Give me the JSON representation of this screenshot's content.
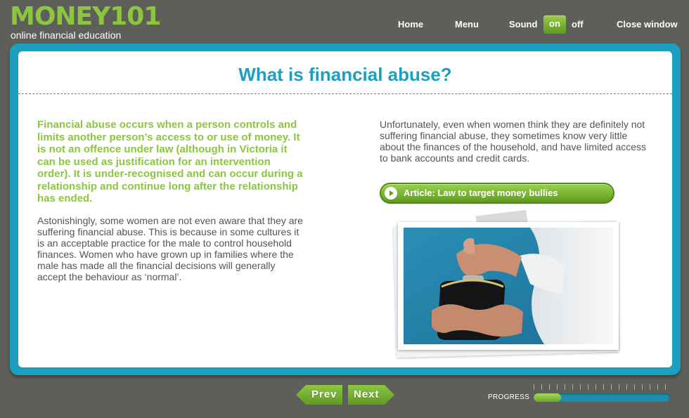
{
  "brand": {
    "logo_text": "MONEY101",
    "tagline": "online financial education"
  },
  "topnav": {
    "home": "Home",
    "menu": "Menu",
    "sound": "Sound",
    "sound_on": "on",
    "sound_off": "off",
    "close": "Close window"
  },
  "page": {
    "title": "What is financial abuse?",
    "intro": "Financial abuse occurs when a person controls and limits another person’s access to or use of money. It is not an offence under law (although in Victoria it can be used as justification for an intervention order). It is under-recognised and can occur during a relationship and continue long after the relationship has ended.",
    "body_left": "Astonishingly, some women are not even aware that they are suffering financial abuse. This is because in some cultures it is an acceptable practice for the male to control household finances. Women who have grown up in families where the male has made all the financial decisions will generally accept the behaviour as ‘normal’.",
    "body_right": "Unfortunately, even when women think they are definitely not suffering financial abuse, they sometimes know very little about the finances of the household, and have limited access to bank accounts and credit cards.",
    "article_button": "Article: Law to target money bullies",
    "photo_icon": "purse-photo"
  },
  "footer": {
    "prev": "Prev",
    "next": "Next",
    "progress_label": "PROGRESS",
    "progress_fraction": 0.2
  },
  "colors": {
    "brand_green": "#8cc63f",
    "accent_teal": "#1ba0bf",
    "background": "#5e5e5b"
  }
}
